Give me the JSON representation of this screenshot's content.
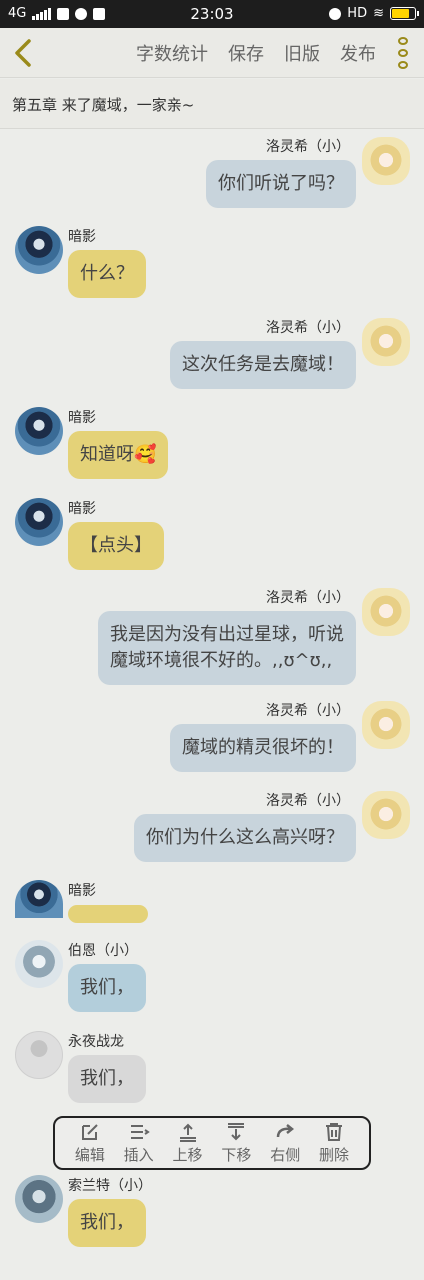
{
  "status": {
    "network": "4G",
    "time": "23:03",
    "hd": "HD"
  },
  "topbar": {
    "actions": [
      {
        "label": "字数统计"
      },
      {
        "label": "保存"
      },
      {
        "label": "旧版"
      },
      {
        "label": "发布"
      }
    ]
  },
  "chapter": {
    "title": "第五章 来了魔域，一家亲~"
  },
  "messages": [
    {
      "side": "right",
      "name": "洛灵希（小）",
      "text": "你们听说了吗？"
    },
    {
      "side": "left",
      "name": "暗影",
      "text": "什么？"
    },
    {
      "side": "right",
      "name": "洛灵希（小）",
      "text": "这次任务是去魔域！"
    },
    {
      "side": "left",
      "name": "暗影",
      "text": "知道呀🥰"
    },
    {
      "side": "left",
      "name": "暗影",
      "text": "【点头】"
    },
    {
      "side": "right",
      "name": "洛灵希（小）",
      "text": "我是因为没有出过星球，听说",
      "text2": "魔域环境很不好的。,,ʊ^ʊ,,"
    },
    {
      "side": "right",
      "name": "洛灵希（小）",
      "text": "魔域的精灵很坏的！"
    },
    {
      "side": "right",
      "name": "洛灵希（小）",
      "text": "你们为什么这么高兴呀？"
    },
    {
      "side": "left",
      "name": "暗影",
      "text": ""
    },
    {
      "side": "left",
      "name": "伯恩（小）",
      "text": "我们，"
    },
    {
      "side": "left",
      "name": "永夜战龙",
      "text": "我们，"
    },
    {
      "side": "left",
      "name": "索兰特（小）",
      "text": "我们，"
    }
  ],
  "toolbar": {
    "items": [
      {
        "label": "编辑",
        "icon": "edit-icon"
      },
      {
        "label": "插入",
        "icon": "insert-icon"
      },
      {
        "label": "上移",
        "icon": "move-up-icon"
      },
      {
        "label": "下移",
        "icon": "move-down-icon"
      },
      {
        "label": "右侧",
        "icon": "redo-icon"
      },
      {
        "label": "删除",
        "icon": "trash-icon"
      }
    ]
  },
  "colors": {
    "background": "#ecedea",
    "accent": "#9a8a1a",
    "bubble_right": "#c8d4dc",
    "bubble_yellow": "#e4d278",
    "bubble_blue": "#b3cedb"
  }
}
